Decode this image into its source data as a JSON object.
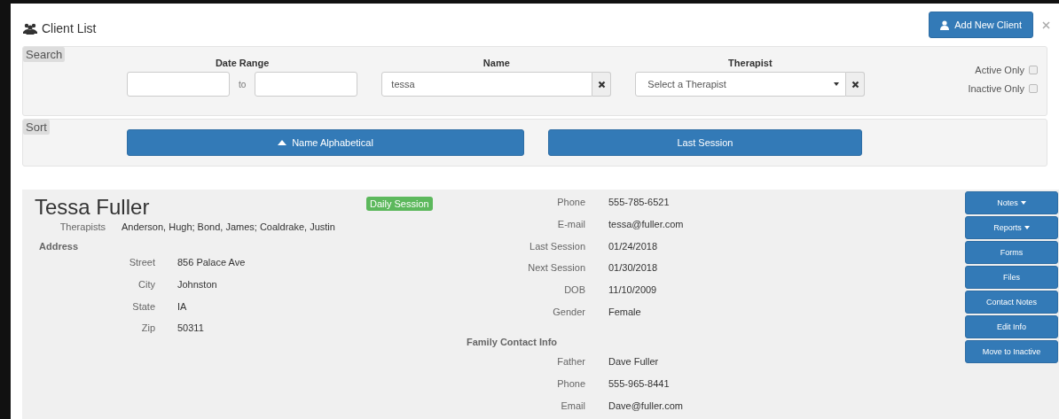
{
  "window": {
    "title": "Client List"
  },
  "add_button": {
    "label": "Add New Client"
  },
  "search": {
    "label": "Search",
    "date_range": {
      "label": "Date Range",
      "separator": "to"
    },
    "name": {
      "label": "Name",
      "value": "tessa"
    },
    "therapist": {
      "label": "Therapist",
      "placeholder": "Select a Therapist"
    },
    "filters": [
      {
        "label": "Active Only",
        "checked": false
      },
      {
        "label": "Inactive Only",
        "checked": false
      }
    ]
  },
  "sort": {
    "label": "Sort",
    "buttons": [
      {
        "label": "Name Alphabetical",
        "selected": true
      },
      {
        "label": "Last Session",
        "selected": false
      }
    ]
  },
  "client": {
    "name": "Tessa Fuller",
    "badge": "Daily Session",
    "therapists": {
      "label": "Therapists",
      "value": "Anderson, Hugh; Bond, James; Coaldrake, Justin"
    },
    "address": {
      "label": "Address",
      "fields": [
        {
          "label": "Street",
          "value": "856 Palace Ave"
        },
        {
          "label": "City",
          "value": "Johnston"
        },
        {
          "label": "State",
          "value": "IA"
        },
        {
          "label": "Zip",
          "value": "50311"
        }
      ]
    },
    "details": [
      {
        "label": "Phone",
        "value": "555-785-6521"
      },
      {
        "label": "E-mail",
        "value": "tessa@fuller.com"
      },
      {
        "label": "Last Session",
        "value": "01/24/2018"
      },
      {
        "label": "Next Session",
        "value": "01/30/2018"
      },
      {
        "label": "DOB",
        "value": "11/10/2009"
      },
      {
        "label": "Gender",
        "value": "Female"
      }
    ],
    "family": {
      "label": "Family Contact Info",
      "fields": [
        {
          "label": "Father",
          "value": "Dave Fuller"
        },
        {
          "label": "Phone",
          "value": "555-965-8441"
        },
        {
          "label": "Email",
          "value": "Dave@fuller.com"
        }
      ]
    },
    "actions": [
      {
        "label": "Notes",
        "dropdown": true
      },
      {
        "label": "Reports",
        "dropdown": true
      },
      {
        "label": "Forms",
        "dropdown": false
      },
      {
        "label": "Files",
        "dropdown": false
      },
      {
        "label": "Contact Notes",
        "dropdown": false
      },
      {
        "label": "Edit Info",
        "dropdown": false
      },
      {
        "label": "Move to Inactive",
        "dropdown": false
      }
    ]
  }
}
